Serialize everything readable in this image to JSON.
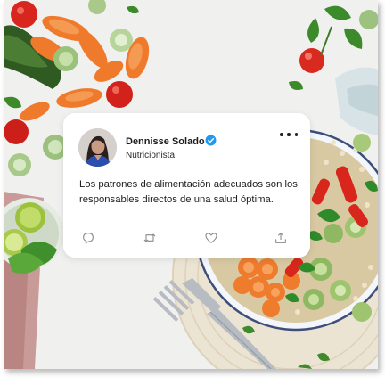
{
  "post": {
    "author_name": "Dennisse Solado",
    "author_role": "Nutricionista",
    "verified": true,
    "text": "Los patrones de alimentación adecuados son los responsables directos de una salud óptima."
  },
  "icons": {
    "verified": "verified-check-icon",
    "more": "more-horizontal-icon",
    "reply": "comment-icon",
    "retweet": "retweet-icon",
    "like": "heart-icon",
    "share": "share-upload-icon"
  },
  "colors": {
    "verified_badge": "#1d9bf0",
    "card_background": "#ffffff",
    "text_primary": "#1b1b1b",
    "icon_gray": "#8a8a8a"
  }
}
